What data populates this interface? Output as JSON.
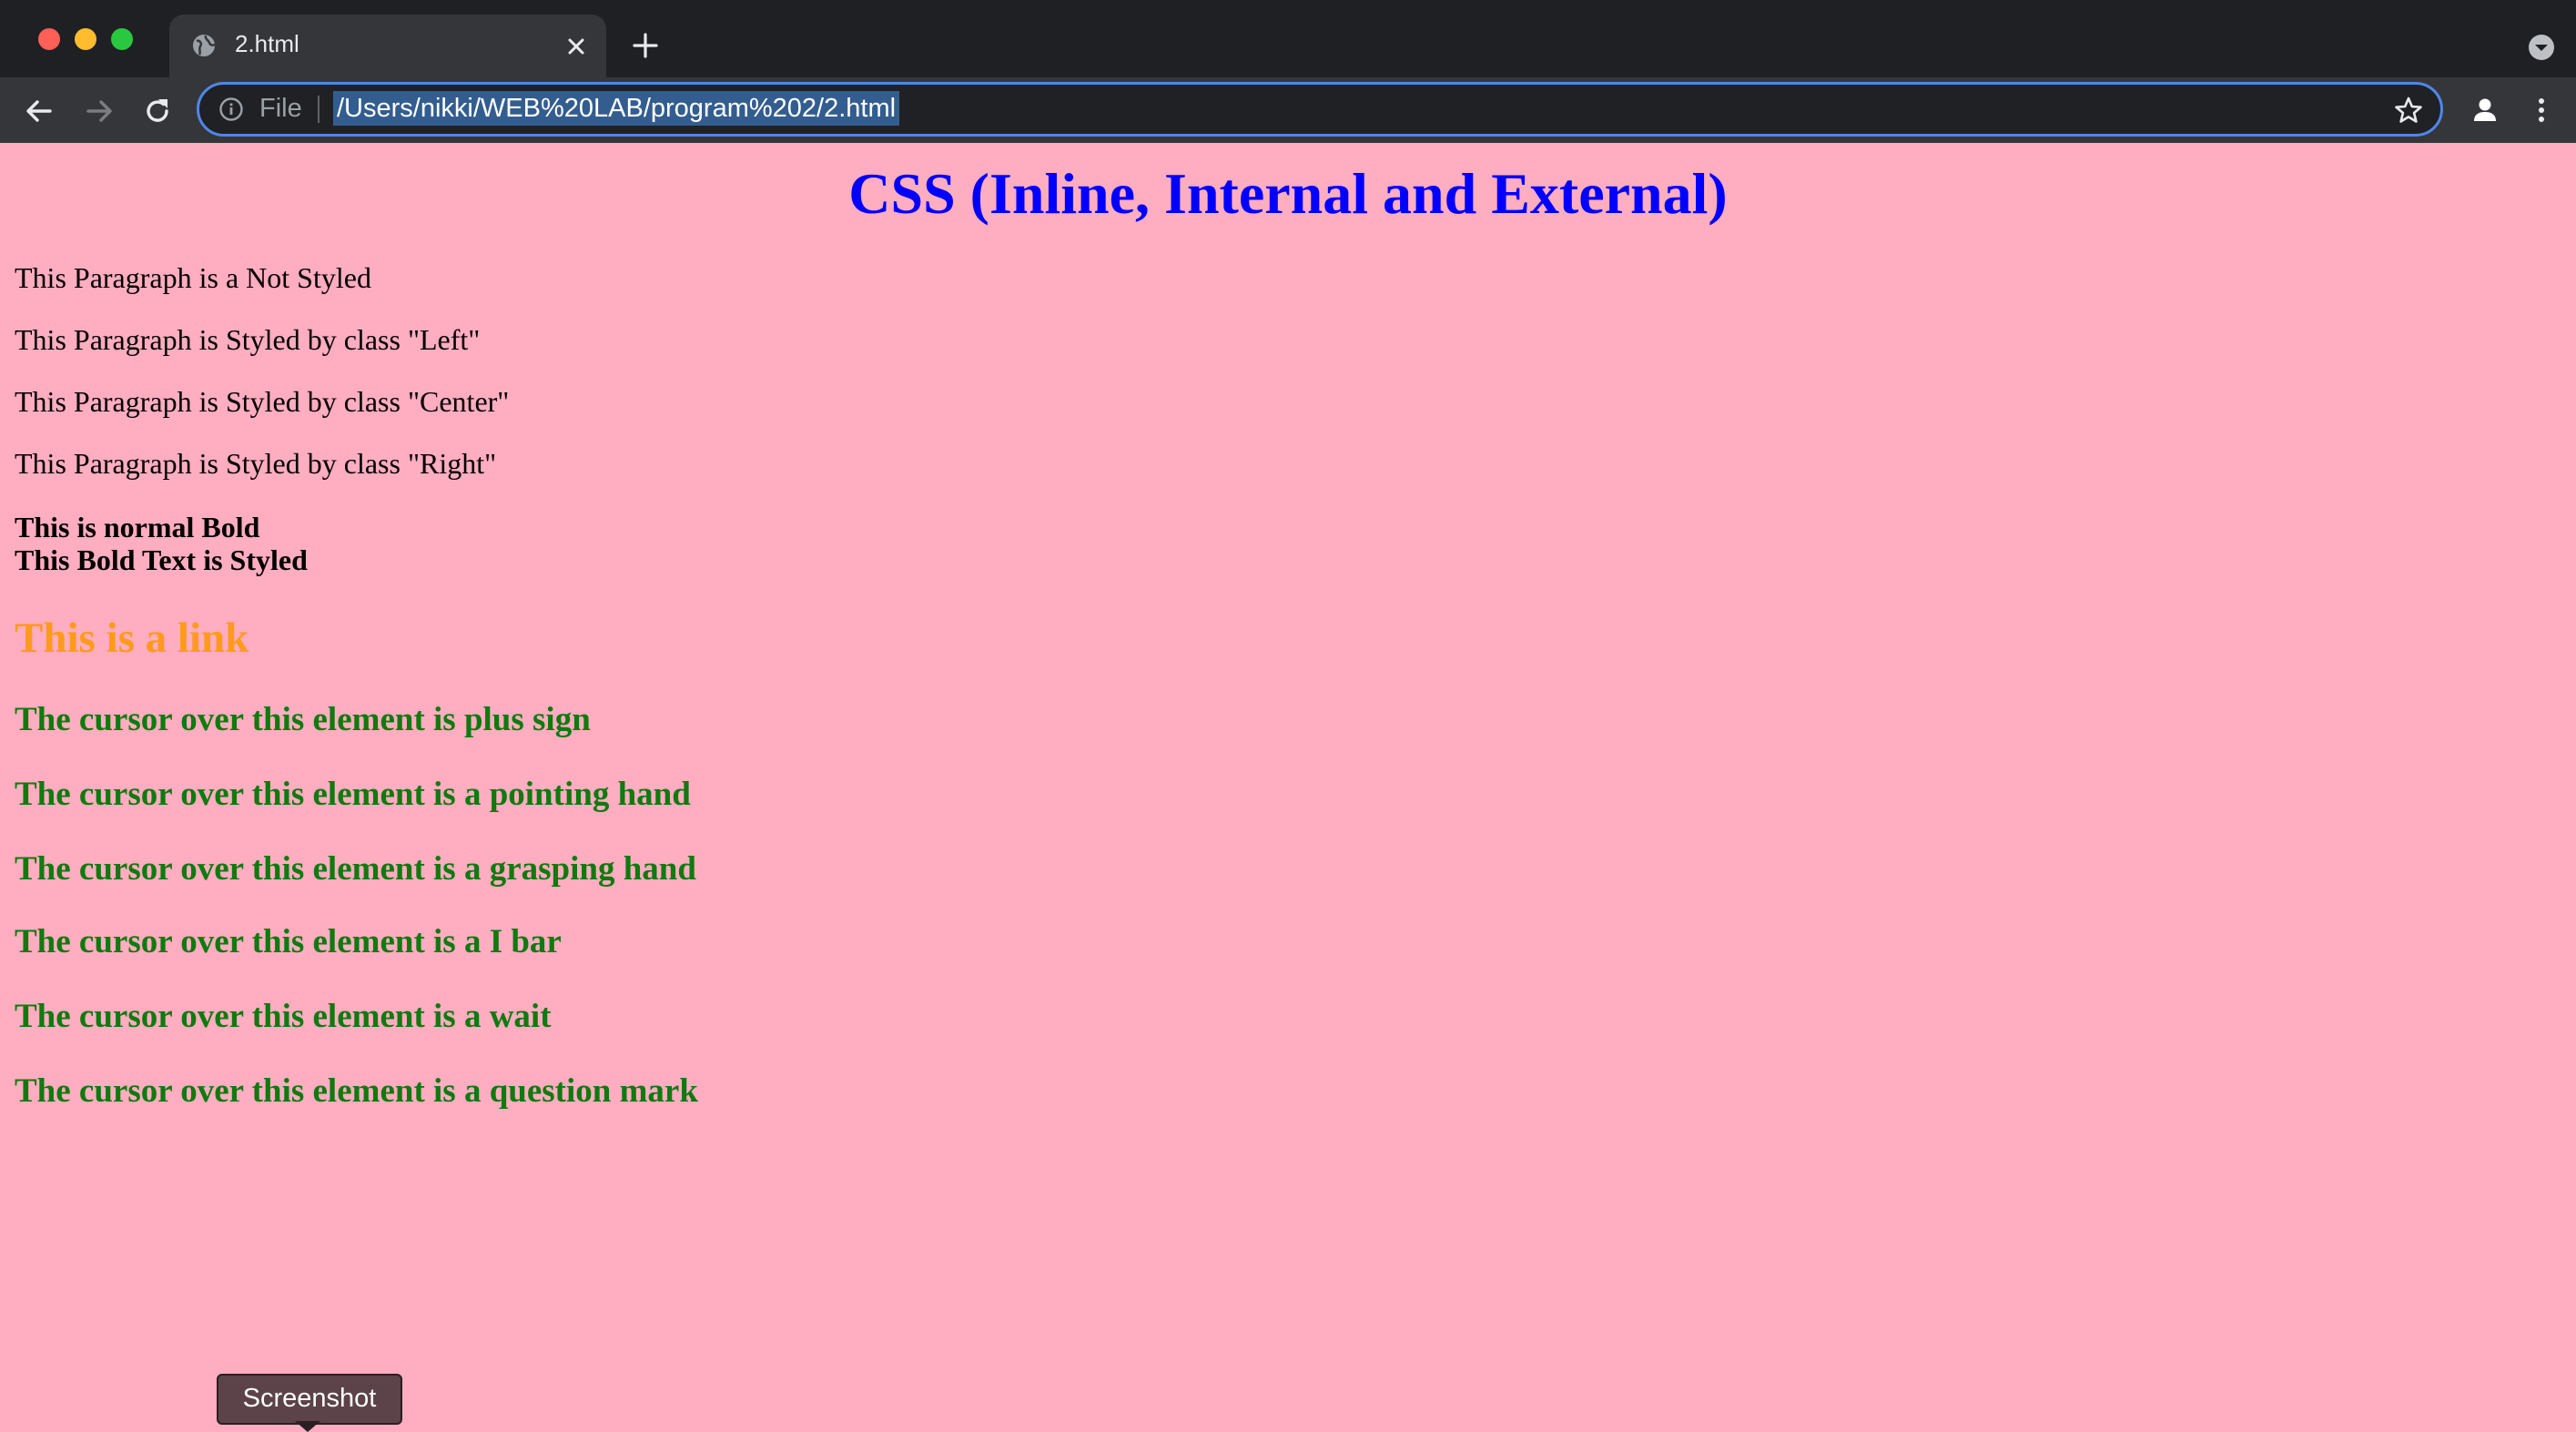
{
  "browser": {
    "tab": {
      "title": "2.html"
    },
    "omnibox": {
      "scheme_label": "File",
      "url": "/Users/nikki/WEB%20LAB/program%202/2.html"
    },
    "icons": {
      "favicon": "globe-icon",
      "close": "close-icon",
      "new_tab": "plus-icon",
      "tab_search": "chevron-down-circle-icon",
      "back": "arrow-left-icon",
      "forward": "arrow-right-icon",
      "reload": "reload-icon",
      "info": "info-icon",
      "bookmark": "star-icon",
      "profile": "person-icon",
      "menu": "kebab-menu-icon"
    },
    "colors": {
      "titlebar": "#1f2023",
      "toolbar": "#35363a",
      "omnibox_border": "#4f87ea",
      "url_selection": "#335d8f"
    }
  },
  "page": {
    "background": "#ffadc0",
    "heading": "CSS (Inline, Internal and External)",
    "paragraphs": [
      "This Paragraph is a Not Styled",
      "This Paragraph is Styled by class \"Left\"",
      "This Paragraph is Styled by class \"Center\"",
      "This Paragraph is Styled by class \"Right\""
    ],
    "bold_lines": [
      "This is normal Bold",
      "This Bold Text is Styled"
    ],
    "link_text": "This is a link",
    "cursor_lines": [
      "The cursor over this element is plus sign",
      "The cursor over this element is a pointing hand",
      "The cursor over this element is a grasping hand",
      "The cursor over this element is a I bar",
      "The cursor over this element is a wait",
      "The cursor over this element is a question mark"
    ],
    "colors": {
      "heading": "#0000ff",
      "link": "#ff9a1a",
      "cursor_text": "#0f7a0f"
    }
  },
  "tooltip": {
    "text": "Screenshot"
  }
}
